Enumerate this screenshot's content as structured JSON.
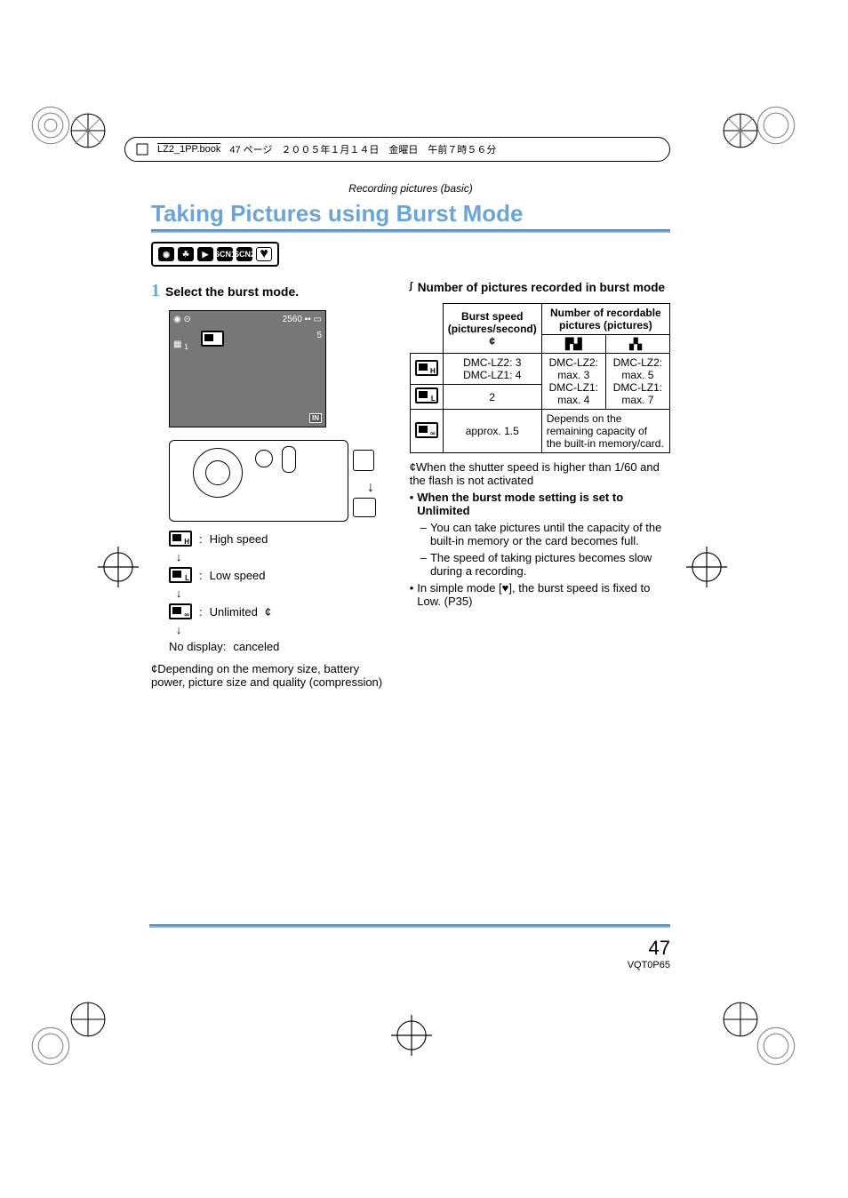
{
  "crop_header": {
    "file": "LZ2_1PP.book",
    "page_jp": "47 ページ",
    "date_jp": "２００５年１月１４日　金曜日　午前７時５６分"
  },
  "section_path": "Recording pictures (basic)",
  "title": "Taking Pictures using Burst Mode",
  "step": {
    "num": "1",
    "text": "Select the burst mode."
  },
  "screenshot_labels": {
    "resolution": "2560",
    "count": "5",
    "hsp_badge": "1",
    "card_label": "IN"
  },
  "mode_list": {
    "high": "High speed",
    "low": "Low speed",
    "unlimited": "Unlimited",
    "unlimited_mark": "¢",
    "no_display": "No display:",
    "canceled": "canceled",
    "arrow": "↓"
  },
  "left_footnote_mark": "¢",
  "left_footnote": "Depending on the memory size, battery power, picture size and quality (compression)",
  "right": {
    "subhead_marker": "∫",
    "subhead": "Number of pictures recorded in burst mode",
    "table": {
      "hdr_speed": "Burst speed (pictures/second)",
      "hdr_speed_mark": "¢",
      "hdr_count": "Number of recordable pictures (pictures)",
      "rows": [
        {
          "speed": "DMC-LZ2: 3\nDMC-LZ1: 4",
          "fine": "DMC-LZ2: max. 3\nDMC-LZ1: max. 4",
          "std": "DMC-LZ2: max. 5\nDMC-LZ1: max. 7"
        },
        {
          "speed": "2"
        },
        {
          "speed": "approx. 1.5",
          "merged": "Depends on the remaining capacity of the built-in memory/card."
        }
      ]
    },
    "table_note_mark": "¢",
    "table_note": "When the shutter speed is higher than 1/60 and the flash is not activated",
    "bullet1": "When the burst mode setting is set to Unlimited",
    "dash1": "You can take pictures until the capacity of the built-in memory or the card becomes full.",
    "dash2": "The speed of taking pictures becomes slow during a recording.",
    "bullet2a": "In simple mode [",
    "bullet2b": "], the burst speed is fixed to Low. (P35)"
  },
  "footer": {
    "page": "47",
    "doc_id": "VQT0P65"
  },
  "chart_data": {
    "type": "table",
    "title": "Number of pictures recorded in burst mode",
    "columns": [
      "Burst mode",
      "Burst speed (pictures/second)",
      "Recordable pictures (Fine)",
      "Recordable pictures (Standard)"
    ],
    "rows": [
      [
        "High speed",
        "DMC-LZ2: 3 / DMC-LZ1: 4",
        "DMC-LZ2: max. 3 / DMC-LZ1: max. 4",
        "DMC-LZ2: max. 5 / DMC-LZ1: max. 7"
      ],
      [
        "Low speed",
        "2",
        "DMC-LZ2: max. 3 / DMC-LZ1: max. 4",
        "DMC-LZ2: max. 5 / DMC-LZ1: max. 7"
      ],
      [
        "Unlimited",
        "approx. 1.5",
        "Depends on the remaining capacity of the built-in memory/card.",
        "Depends on the remaining capacity of the built-in memory/card."
      ]
    ]
  }
}
